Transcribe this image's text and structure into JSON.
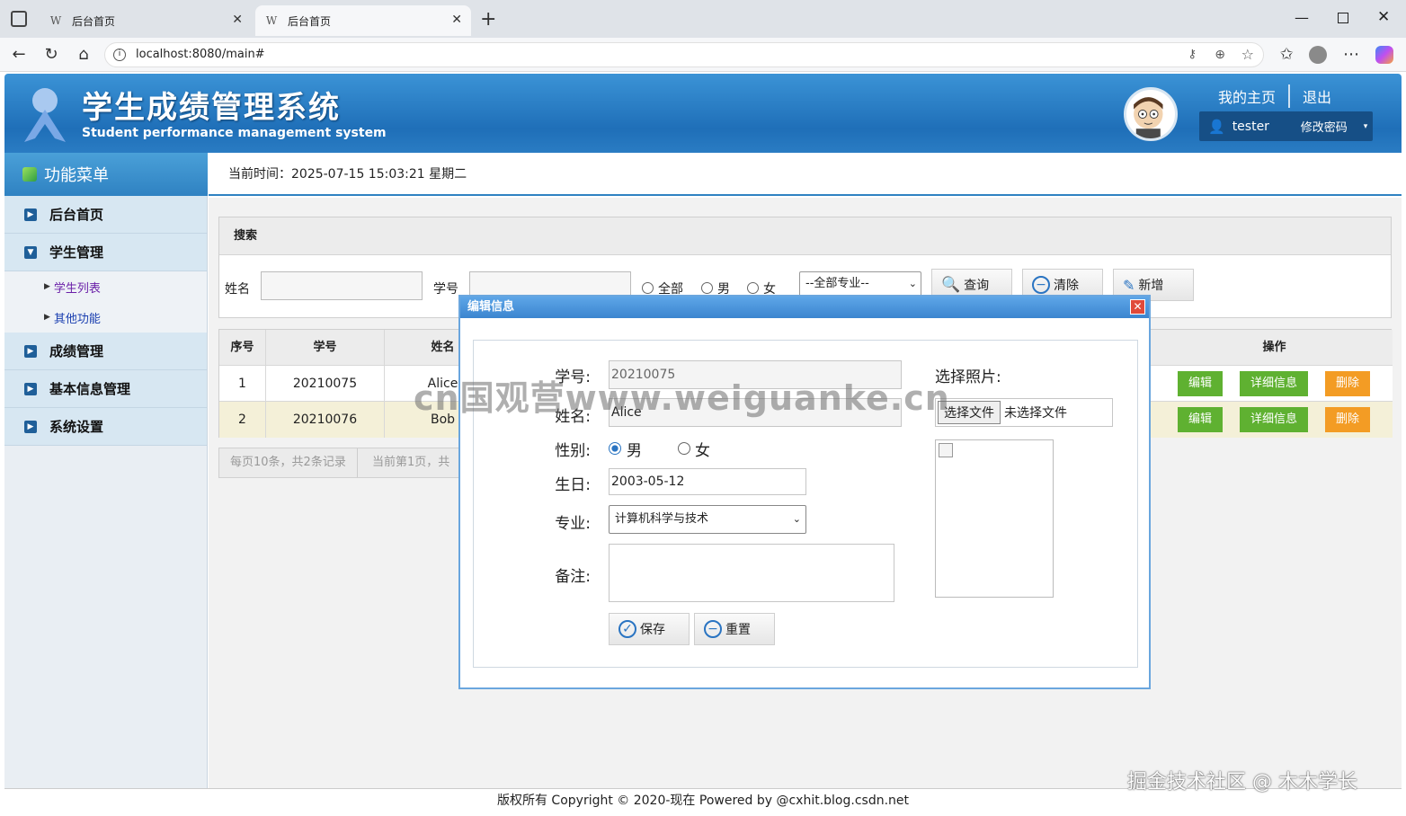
{
  "browser": {
    "tabs": [
      {
        "title": "后台首页",
        "favicon": "W"
      },
      {
        "title": "后台首页",
        "favicon": "W"
      }
    ],
    "url": "localhost:8080/main#"
  },
  "header": {
    "title": "学生成绩管理系统",
    "subtitle": "Student performance management system",
    "home_link": "我的主页",
    "logout_link": "退出",
    "username": "tester",
    "change_password": "修改密码"
  },
  "sidebar": {
    "title": "功能菜单",
    "items": [
      {
        "label": "后台首页"
      },
      {
        "label": "学生管理",
        "children": [
          "学生列表",
          "其他功能"
        ]
      },
      {
        "label": "成绩管理"
      },
      {
        "label": "基本信息管理"
      },
      {
        "label": "系统设置"
      }
    ]
  },
  "timebar": {
    "text": "当前时间：2025-07-15 15:03:21 星期二"
  },
  "search": {
    "title": "搜索",
    "name_label": "姓名",
    "id_label": "学号",
    "gender_options": [
      "全部",
      "男",
      "女"
    ],
    "major_select": "--全部专业--",
    "query_button": "查询",
    "clear_button": "清除",
    "add_button": "新增"
  },
  "table": {
    "columns": [
      "序号",
      "学号",
      "姓名",
      "操作"
    ],
    "rows": [
      {
        "index": "1",
        "id": "20210075",
        "name": "Alice"
      },
      {
        "index": "2",
        "id": "20210076",
        "name": "Bob"
      }
    ],
    "actions": [
      "编辑",
      "详细信息",
      "删除"
    ]
  },
  "pager": {
    "summary": "每页10条，共2条记录",
    "current": "当前第1页，共"
  },
  "dialog": {
    "title": "编辑信息",
    "id_label": "学号:",
    "id_value": "20210075",
    "name_label": "姓名:",
    "name_value": "Alice",
    "gender_label": "性别:",
    "gender_male": "男",
    "gender_female": "女",
    "birthday_label": "生日:",
    "birthday_value": "2003-05-12",
    "major_label": "专业:",
    "major_value": "计算机科学与技术",
    "notes_label": "备注:",
    "photo_label": "选择照片:",
    "choose_file_button": "选择文件",
    "no_file_text": "未选择文件",
    "save_button": "保存",
    "reset_button": "重置"
  },
  "footer": {
    "text": "版权所有 Copyright © 2020-现在 Powered by @cxhit.blog.csdn.net"
  },
  "watermarks": [
    "cn国观营www.weiguanke.cn",
    "掘金技术社区 @ 木木学长"
  ],
  "colors": {
    "accent": "#1f6fb8",
    "edit_button": "#5fb131",
    "detail_button": "#5fb131",
    "delete_button": "#f39c24"
  }
}
